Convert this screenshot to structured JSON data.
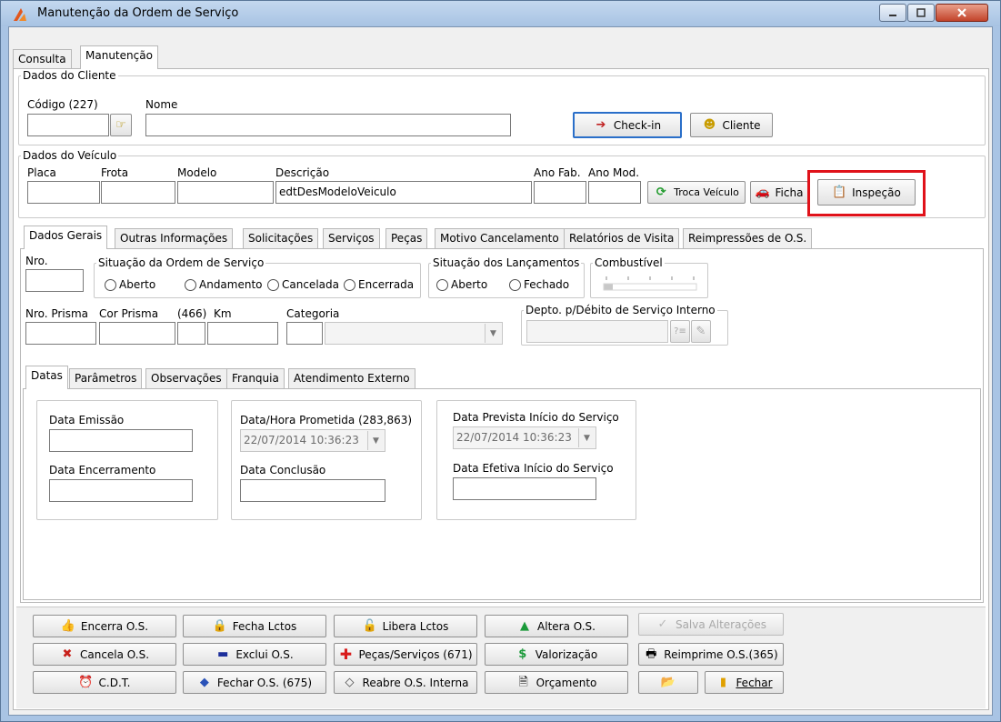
{
  "window": {
    "title": "Manutenção da Ordem de Serviço"
  },
  "main_tabs": [
    "Consulta",
    "Manutenção"
  ],
  "cliente": {
    "legend": "Dados do Cliente",
    "codigo_label": "Código (227)",
    "nome_label": "Nome",
    "checkin_label": "Check-in",
    "cliente_label": "Cliente"
  },
  "veiculo": {
    "legend": "Dados do Veículo",
    "placa_label": "Placa",
    "frota_label": "Frota",
    "modelo_label": "Modelo",
    "descricao_label": "Descrição",
    "descricao_value": "edtDesModeloVeiculo",
    "ano_fab_label": "Ano Fab.",
    "ano_mod_label": "Ano Mod.",
    "troca_label": "Troca Veículo",
    "ficha_label": "Ficha",
    "inspecao_label": "Inspeção"
  },
  "section_tabs": [
    "Dados Gerais",
    "Outras Informações",
    "Solicitações",
    "Serviços",
    "Peças",
    "Motivo Cancelamento",
    "Relatórios de Visita",
    "Reimpressões de O.S."
  ],
  "dados_gerais": {
    "nro_label": "Nro.",
    "situacao_os_legend": "Situação da Ordem de Serviço",
    "situacao_os_options": [
      "Aberto",
      "Andamento",
      "Cancelada",
      "Encerrada"
    ],
    "situacao_lanc_legend": "Situação dos Lançamentos",
    "situacao_lanc_options": [
      "Aberto",
      "Fechado"
    ],
    "combustivel_legend": "Combustível",
    "nro_prisma_label": "Nro. Prisma",
    "cor_prisma_label": "Cor Prisma",
    "km_code_label": "(466)",
    "km_label": "Km",
    "categoria_label": "Categoria",
    "depto_legend": "Depto. p/Débito de Serviço Interno"
  },
  "sub_tabs": [
    "Datas",
    "Parâmetros",
    "Observações",
    "Franquia",
    "Atendimento Externo"
  ],
  "datas": {
    "emissao_label": "Data Emissão",
    "encerramento_label": "Data Encerramento",
    "prometida_label": "Data/Hora Prometida (283,863)",
    "prometida_value": "22/07/2014 10:36:23",
    "conclusao_label": "Data Conclusão",
    "prevista_label": "Data Prevista Início do Serviço",
    "prevista_value": "22/07/2014 10:36:23",
    "efetiva_label": "Data Efetiva Início do Serviço"
  },
  "bottom_buttons": {
    "encerra": "Encerra O.S.",
    "fecha_lctos": "Fecha Lctos",
    "libera_lctos": "Libera Lctos",
    "altera": "Altera O.S.",
    "salva": "Salva Alterações",
    "cancela": "Cancela O.S.",
    "exclui": "Exclui O.S.",
    "pecas_servicos": "Peças/Serviços (671)",
    "valorizacao": "Valorização",
    "reimprime": "Reimprime O.S.(365)",
    "cdt": "C.D.T.",
    "fechar_os": "Fechar O.S. (675)",
    "reabre": "Reabre O.S. Interna",
    "orcamento": "Orçamento",
    "fechar": "Fechar"
  },
  "colors": {
    "accent": "#2a6fc9",
    "highlight": "#e0121a",
    "window_frame": "#a9c4e4"
  }
}
